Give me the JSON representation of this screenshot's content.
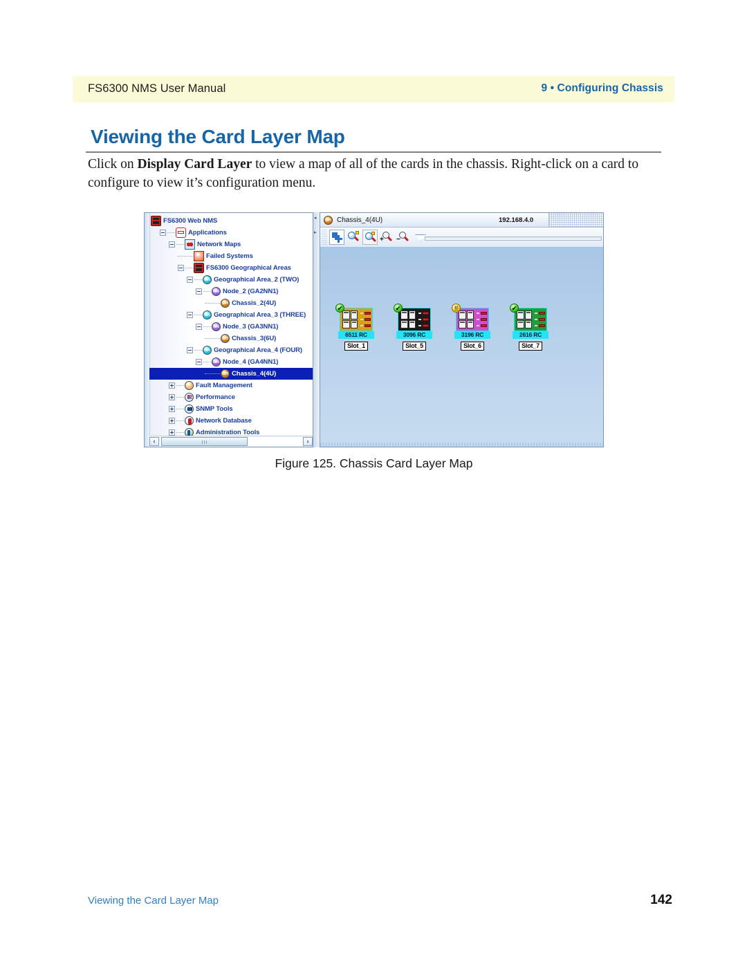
{
  "header": {
    "left": "FS6300 NMS User Manual",
    "right": "9 • Configuring Chassis"
  },
  "section": {
    "title": "Viewing the Card Layer Map",
    "paragraph_pre": "Click on ",
    "paragraph_bold": "Display Card Layer",
    "paragraph_post": " to view a map of all of the cards in the chassis. Right-click on a card to configure to view it’s configuration menu."
  },
  "figure": {
    "caption": "Figure 125. Chassis Card Layer Map",
    "tree": {
      "items": [
        {
          "label": "FS6300 Web NMS",
          "icon": "nms-icon",
          "depth": 0,
          "expander": "none",
          "selected": false,
          "icon_text": ""
        },
        {
          "label": "Applications",
          "icon": "applications-icon",
          "depth": 1,
          "expander": "minus",
          "selected": false,
          "icon_text": ""
        },
        {
          "label": "Network Maps",
          "icon": "network-maps-icon",
          "depth": 2,
          "expander": "minus",
          "selected": false,
          "icon_text": ""
        },
        {
          "label": "Failed Systems",
          "icon": "failed-systems-icon",
          "depth": 3,
          "expander": "stub",
          "selected": false,
          "icon_text": ""
        },
        {
          "label": "FS6300 Geographical Areas",
          "icon": "nms-icon",
          "depth": 3,
          "expander": "minus",
          "selected": false,
          "icon_text": ""
        },
        {
          "label": "Geographical Area_2 (TWO)",
          "icon": "geographical-area-icon",
          "depth": 4,
          "expander": "minus",
          "selected": false,
          "icon_text": "GA"
        },
        {
          "label": "Node_2 (GA2NN1)",
          "icon": "node-icon",
          "depth": 5,
          "expander": "minus",
          "selected": false,
          "icon_text": "NN"
        },
        {
          "label": "Chassis_2(4U)",
          "icon": "chassis-icon",
          "depth": 6,
          "expander": "stub",
          "selected": false,
          "icon_text": "CH"
        },
        {
          "label": "Geographical Area_3 (THREE)",
          "icon": "geographical-area-icon",
          "depth": 4,
          "expander": "minus",
          "selected": false,
          "icon_text": "GA"
        },
        {
          "label": "Node_3 (GA3NN1)",
          "icon": "node-icon",
          "depth": 5,
          "expander": "minus",
          "selected": false,
          "icon_text": "NN"
        },
        {
          "label": "Chassis_3(6U)",
          "icon": "chassis-icon",
          "depth": 6,
          "expander": "stub",
          "selected": false,
          "icon_text": "CH"
        },
        {
          "label": "Geographical Area_4 (FOUR)",
          "icon": "geographical-area-icon",
          "depth": 4,
          "expander": "minus",
          "selected": false,
          "icon_text": "GA"
        },
        {
          "label": "Node_4 (GA4NN1)",
          "icon": "node-icon",
          "depth": 5,
          "expander": "minus",
          "selected": false,
          "icon_text": "NN"
        },
        {
          "label": "Chassis_4(4U)",
          "icon": "chassis-icon",
          "depth": 6,
          "expander": "stub",
          "selected": true,
          "icon_text": "CH"
        },
        {
          "label": "Fault Management",
          "icon": "fault-management-icon",
          "depth": 2,
          "expander": "plus",
          "selected": false,
          "icon_text": ""
        },
        {
          "label": "Performance",
          "icon": "performance-icon",
          "depth": 2,
          "expander": "plus",
          "selected": false,
          "icon_text": ""
        },
        {
          "label": "SNMP Tools",
          "icon": "snmp-tools-icon",
          "depth": 2,
          "expander": "plus",
          "selected": false,
          "icon_text": ""
        },
        {
          "label": "Network Database",
          "icon": "network-database-icon",
          "depth": 2,
          "expander": "plus",
          "selected": false,
          "icon_text": ""
        },
        {
          "label": "Administration Tools",
          "icon": "administration-tools-icon",
          "depth": 2,
          "expander": "plus",
          "selected": false,
          "icon_text": ""
        }
      ],
      "scroll_left_glyph": "‹",
      "scroll_right_glyph": "›"
    },
    "map": {
      "title": "Chassis_4(4U)",
      "title_icon_text": "CH",
      "ip": "192.168.4.0",
      "toolbar": [
        {
          "name": "select-tool",
          "state": "pressed"
        },
        {
          "name": "zoom-fit-tool",
          "state": "normal"
        },
        {
          "name": "zoom-selection-tool",
          "state": "outlined"
        },
        {
          "name": "zoom-in-tool",
          "state": "normal",
          "sign": "+"
        },
        {
          "name": "zoom-out-tool",
          "state": "normal",
          "sign": "−"
        }
      ],
      "cards": [
        {
          "name": "6511 RC",
          "slot": "Slot_1",
          "status": "ok",
          "status_glyph": "✔",
          "color": "#d8a018"
        },
        {
          "name": "3096 RC",
          "slot": "Slot_5",
          "status": "ok",
          "status_glyph": "✔",
          "color": "#1a1a1a"
        },
        {
          "name": "3196 RC",
          "slot": "Slot_6",
          "status": "warn",
          "status_glyph": "‼",
          "color": "#cc4fd0"
        },
        {
          "name": "2616 RC",
          "slot": "Slot_7",
          "status": "ok",
          "status_glyph": "✔",
          "color": "#1f9e38"
        }
      ]
    }
  },
  "footer": {
    "left": "Viewing the Card Layer Map",
    "page": "142"
  },
  "colors": {
    "brand_blue": "#1565a8",
    "header_band": "#fcfbd8",
    "tree_text": "#1a3fa0",
    "selection": "#0a1fb4",
    "card_label_bg": "#23e3f7"
  }
}
